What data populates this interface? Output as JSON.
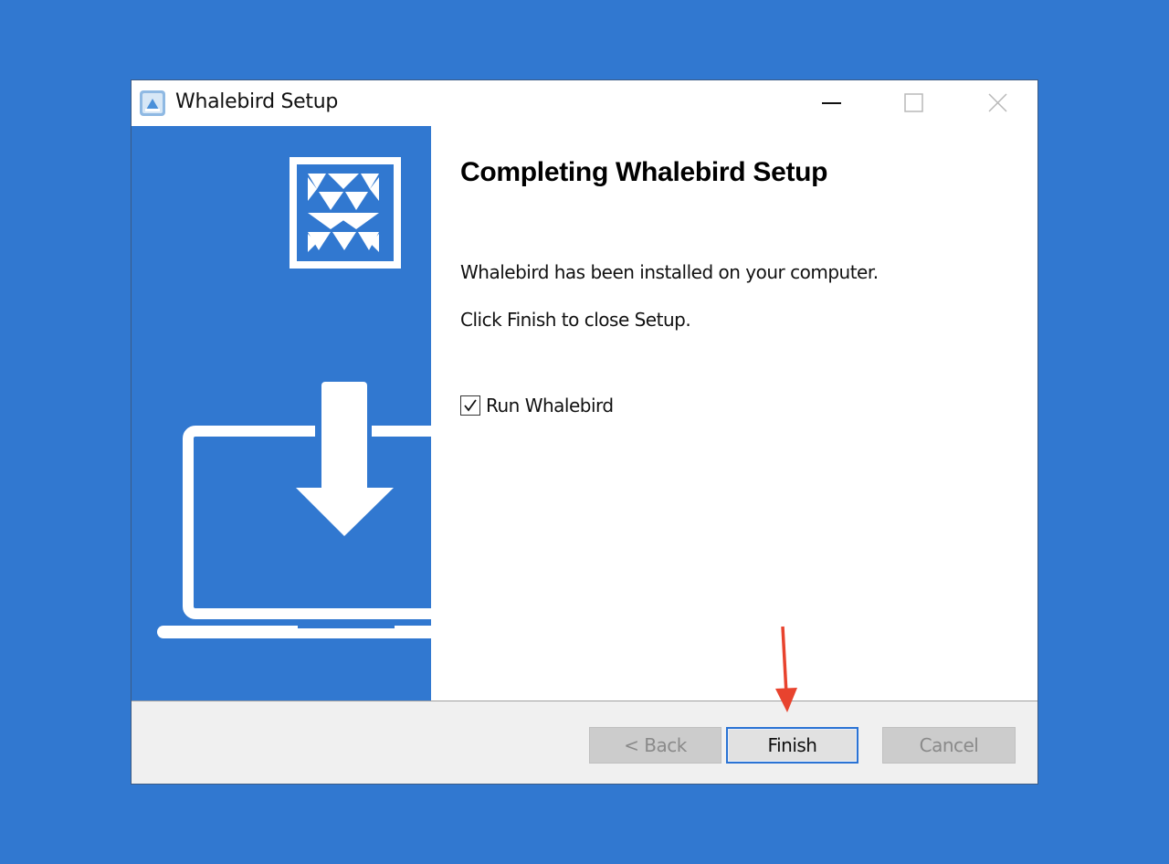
{
  "window": {
    "title": "Whalebird Setup",
    "controls": {
      "minimize": "minimize-icon",
      "maximize": "maximize-icon",
      "close": "close-icon"
    }
  },
  "side_panel": {
    "logo": "whalebird-logo-icon",
    "illustration": "laptop-download-icon"
  },
  "content": {
    "heading": "Completing Whalebird Setup",
    "installed_text": "Whalebird has been installed on your computer.",
    "finish_instruction": "Click Finish to close Setup.",
    "run_checkbox": {
      "label": "Run Whalebird",
      "checked": true
    }
  },
  "footer": {
    "back_label": "< Back",
    "finish_label": "Finish",
    "cancel_label": "Cancel"
  },
  "colors": {
    "desktop_background": "#3178d0",
    "side_panel": "#3178d0",
    "finish_border": "#2a73d4",
    "annotation_arrow": "#e8432e"
  }
}
